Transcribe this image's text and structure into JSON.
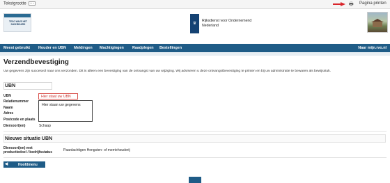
{
  "topbar": {
    "font_size_label": "Tekstgrootte",
    "font_size_button": "+ −",
    "print_label": "Pagina printen",
    "print_icon": "printer-icon",
    "arrow_color": "#d9262c"
  },
  "header": {
    "small_logo_text": "TESO WAVE HET DASHBOARD",
    "org_name_line1": "Rijksdienst voor Ondernemend",
    "org_name_line2": "Nederland",
    "emblem_icon": "crown-emblem-icon",
    "brand_color": "#154273"
  },
  "nav": {
    "items": [
      "Meest gebruikt",
      "Houder en UBN",
      "Meldingen",
      "Machtigingen",
      "Raadplegen",
      "Bestellingen"
    ],
    "right_link": "Naar mijn.rvo.nl",
    "color": "#1f5c87"
  },
  "main": {
    "title": "Verzendbevestiging",
    "intro": "Uw gegevens zijn succesvol naar ons verzonden. Dit is alleen een bevestiging van de ontvangst van uw wijziging. Wij adviseren u deze ontvangstbevestiging te printen en bij uw administratie te bewaren als bewijsstuk.",
    "ubn_section": {
      "title": "UBN",
      "fields": [
        {
          "label": "UBN",
          "value": ""
        },
        {
          "label": "Relatienummer",
          "value": ""
        },
        {
          "label": "Naam",
          "value": ""
        },
        {
          "label": "Adres",
          "value": ""
        },
        {
          "label": "Postcode en plaats",
          "value": ""
        },
        {
          "label": "Diersoort(en)",
          "value": "Schaap"
        }
      ],
      "ubn_hint": "Hier staat uw UBN",
      "details_hint": "Hier staan uw gegevens"
    },
    "new_section": {
      "title": "Nieuwe situatie UBN",
      "label_line1": "Diersoort(en) met",
      "label_line2": "productiedoel / bedrijfsstatus",
      "value": "Paardachtigen Hengsten- of merriehouderij"
    },
    "home_button": "Hoofdmenu",
    "home_icon": "arrow-left-icon"
  }
}
